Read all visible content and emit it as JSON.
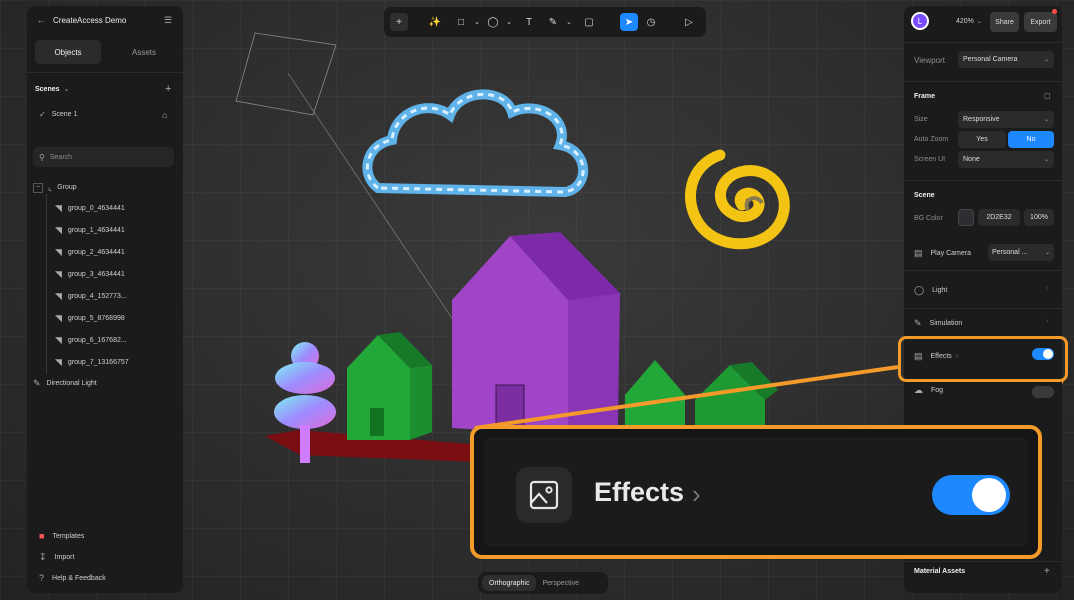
{
  "left_panel": {
    "project_title": "CreateAccess Demo",
    "tabs": [
      "Objects",
      "Assets"
    ],
    "scenes_label": "Scenes",
    "scene_item": "Scene 1",
    "search_placeholder": "Search",
    "group_label": "Group",
    "children": [
      "group_0_4634441",
      "group_1_4634441",
      "group_2_4634441",
      "group_3_4634441",
      "group_4_152773...",
      "group_5_8768998",
      "group_6_167682...",
      "group_7_13166757"
    ],
    "light_label": "Directional Light",
    "footer": [
      "Templates",
      "Import",
      "Help & Feedback"
    ]
  },
  "toolbar": {
    "icons": [
      "plus-icon",
      "magic-icon",
      "square-icon",
      "chevron-down-icon",
      "sphere-icon",
      "chevron-down-icon",
      "text-icon",
      "pen-icon",
      "chevron-down-icon",
      "comment-icon",
      "cursor-icon",
      "clock-icon",
      "play-icon"
    ]
  },
  "viewport_toggle": {
    "options": [
      "Orthographic",
      "Perspective"
    ],
    "active": "Orthographic"
  },
  "right_panel": {
    "avatar_letter": "L",
    "zoom": "420%",
    "share_label": "Share",
    "export_label": "Export",
    "viewport_label": "Viewport",
    "viewport_value": "Personal Camera",
    "frame_title": "Frame",
    "size_label": "Size",
    "size_value": "Responsive",
    "auto_zoom_label": "Auto Zoom",
    "yes_label": "Yes",
    "no_label": "No",
    "screen_ui_label": "Screen UI",
    "screen_ui_value": "None",
    "scene_title": "Scene",
    "bg_color_label": "BG Color",
    "bg_color_value": "2D2E32",
    "bg_opacity": "100%",
    "play_camera_label": "Play Camera",
    "play_camera_value": "Personal ...",
    "light_label": "Light",
    "simulation_label": "Simulation",
    "effects_label": "Effects",
    "fog_label": "Fog",
    "material_assets_label": "Material Assets"
  },
  "callout": {
    "label": "Effects",
    "toggle_on": true
  },
  "colors": {
    "accent": "#1E88FF",
    "highlight": "#F39A2A"
  }
}
